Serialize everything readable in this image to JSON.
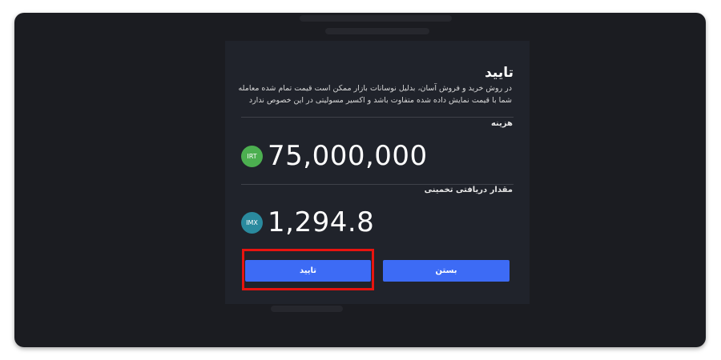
{
  "dialog": {
    "title": "تایید",
    "description": "در روش خرید و فروش آسان، بدلیل نوسانات بازار ممکن است قیمت تمام شده معامله شما با قیمت نمایش داده شده متفاوت باشد و اکسیر مسولیتی در این خصوص ندارد",
    "cost": {
      "label": "هزینه",
      "currency_badge": "IRT",
      "value": "75,000,000"
    },
    "estimated_receive": {
      "label": "مقدار دریافتی تخمینی",
      "currency_badge": "IMX",
      "value": "1,294.8"
    },
    "buttons": {
      "confirm_label": "تایید",
      "close_label": "بستن"
    }
  },
  "colors": {
    "backdrop": "#1b1c21",
    "dialog_bg": "#20232b",
    "button_blue": "#3d6bf5",
    "irt_badge": "#4caf50",
    "imx_badge": "#2a8a9e",
    "highlight_red": "#e8140f"
  },
  "icons": {
    "irt": "irt-currency-icon",
    "imx": "imx-token-icon"
  }
}
